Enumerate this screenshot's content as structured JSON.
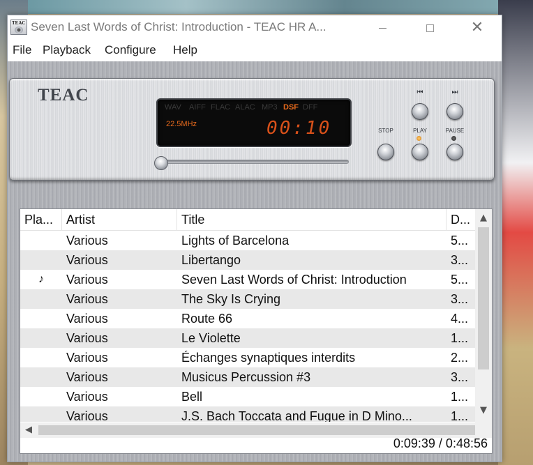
{
  "window": {
    "title": "Seven Last Words of Christ: Introduction - TEAC HR A..."
  },
  "menu": [
    "File",
    "Playback",
    "Configure",
    "Help"
  ],
  "player": {
    "brand": "TEAC",
    "formats": [
      "WAV",
      "AIFF",
      "FLAC",
      "ALAC",
      "MP3",
      "DSF",
      "DFF"
    ],
    "active_format": "DSF",
    "sample_rate": "22.5MHz",
    "time": "00:10",
    "seek_fraction": 0.02,
    "controls": {
      "prev_label": "⏮",
      "next_label": "⏭",
      "stop_label": "STOP",
      "play_label": "PLAY",
      "pause_label": "PAUSE"
    },
    "play_led_on": true,
    "pause_led_on": false
  },
  "playlist": {
    "columns": [
      "Pla...",
      "Artist",
      "Title",
      "D..."
    ],
    "rows": [
      {
        "playing": "",
        "artist": "Various",
        "title": "Lights of Barcelona",
        "duration": "5..."
      },
      {
        "playing": "",
        "artist": "Various",
        "title": "Libertango",
        "duration": "3..."
      },
      {
        "playing": "♪",
        "artist": "Various",
        "title": "Seven Last Words of Christ: Introduction",
        "duration": "5..."
      },
      {
        "playing": "",
        "artist": "Various",
        "title": "The Sky Is Crying",
        "duration": "3..."
      },
      {
        "playing": "",
        "artist": "Various",
        "title": "Route 66",
        "duration": "4..."
      },
      {
        "playing": "",
        "artist": "Various",
        "title": "Le Violette",
        "duration": "1..."
      },
      {
        "playing": "",
        "artist": "Various",
        "title": "Échanges synaptiques interdits",
        "duration": "2..."
      },
      {
        "playing": "",
        "artist": "Various",
        "title": "Musicus Percussion #3",
        "duration": "3..."
      },
      {
        "playing": "",
        "artist": "Various",
        "title": "Bell",
        "duration": "1..."
      },
      {
        "playing": "",
        "artist": "Various",
        "title": "J.S. Bach Toccata and Fugue in D Mino...",
        "duration": "1..."
      }
    ],
    "status": "0:09:39 / 0:48:56"
  },
  "icons": {
    "scroll_up": "▲",
    "scroll_down": "▼",
    "scroll_left": "◀"
  }
}
